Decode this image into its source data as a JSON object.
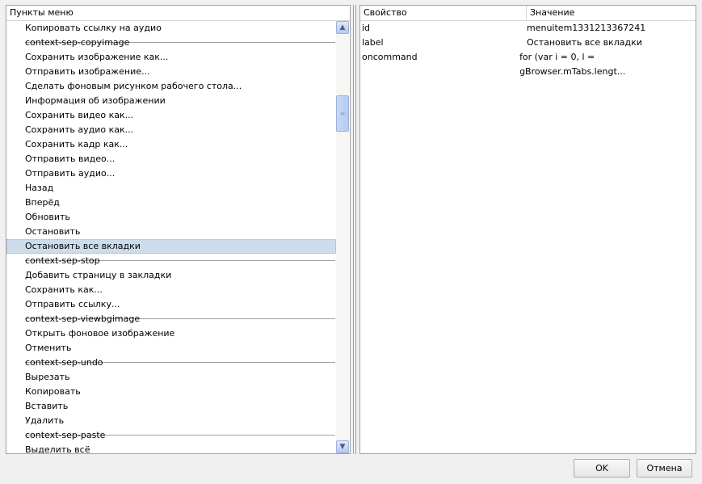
{
  "left_panel": {
    "header": "Пункты меню",
    "items": [
      {
        "label": "Копировать ссылку на аудио",
        "sep": false
      },
      {
        "label": "context-sep-copyimage",
        "sep": true
      },
      {
        "label": "Сохранить изображение как...",
        "sep": false
      },
      {
        "label": "Отправить изображение...",
        "sep": false
      },
      {
        "label": "Сделать фоновым рисунком рабочего стола...",
        "sep": false
      },
      {
        "label": "Информация об изображении",
        "sep": false
      },
      {
        "label": "Сохранить видео как...",
        "sep": false
      },
      {
        "label": "Сохранить аудио как...",
        "sep": false
      },
      {
        "label": "Сохранить кадр как...",
        "sep": false
      },
      {
        "label": "Отправить видео...",
        "sep": false
      },
      {
        "label": "Отправить аудио...",
        "sep": false
      },
      {
        "label": "Назад",
        "sep": false
      },
      {
        "label": "Вперёд",
        "sep": false
      },
      {
        "label": "Обновить",
        "sep": false
      },
      {
        "label": "Остановить",
        "sep": false
      },
      {
        "label": "Остановить все вкладки",
        "sep": false,
        "selected": true
      },
      {
        "label": "context-sep-stop",
        "sep": true
      },
      {
        "label": "Добавить страницу в закладки",
        "sep": false
      },
      {
        "label": "Сохранить как...",
        "sep": false
      },
      {
        "label": "Отправить ссылку...",
        "sep": false
      },
      {
        "label": "context-sep-viewbgimage",
        "sep": true
      },
      {
        "label": "Открыть фоновое изображение",
        "sep": false
      },
      {
        "label": "Отменить",
        "sep": false
      },
      {
        "label": "context-sep-undo",
        "sep": true
      },
      {
        "label": "Вырезать",
        "sep": false
      },
      {
        "label": "Копировать",
        "sep": false
      },
      {
        "label": "Вставить",
        "sep": false
      },
      {
        "label": "Удалить",
        "sep": false
      },
      {
        "label": "context-sep-paste",
        "sep": true
      },
      {
        "label": "Выделить всё",
        "sep": false
      }
    ]
  },
  "right_panel": {
    "headers": [
      "Свойство",
      "Значение"
    ],
    "rows": [
      [
        "id",
        "menuitem1331213367241"
      ],
      [
        "label",
        "Остановить все вкладки"
      ],
      [
        "oncommand",
        "for (var i = 0, l = gBrowser.mTabs.lengt..."
      ]
    ]
  },
  "buttons": {
    "ok": "OK",
    "cancel": "Отмена"
  }
}
